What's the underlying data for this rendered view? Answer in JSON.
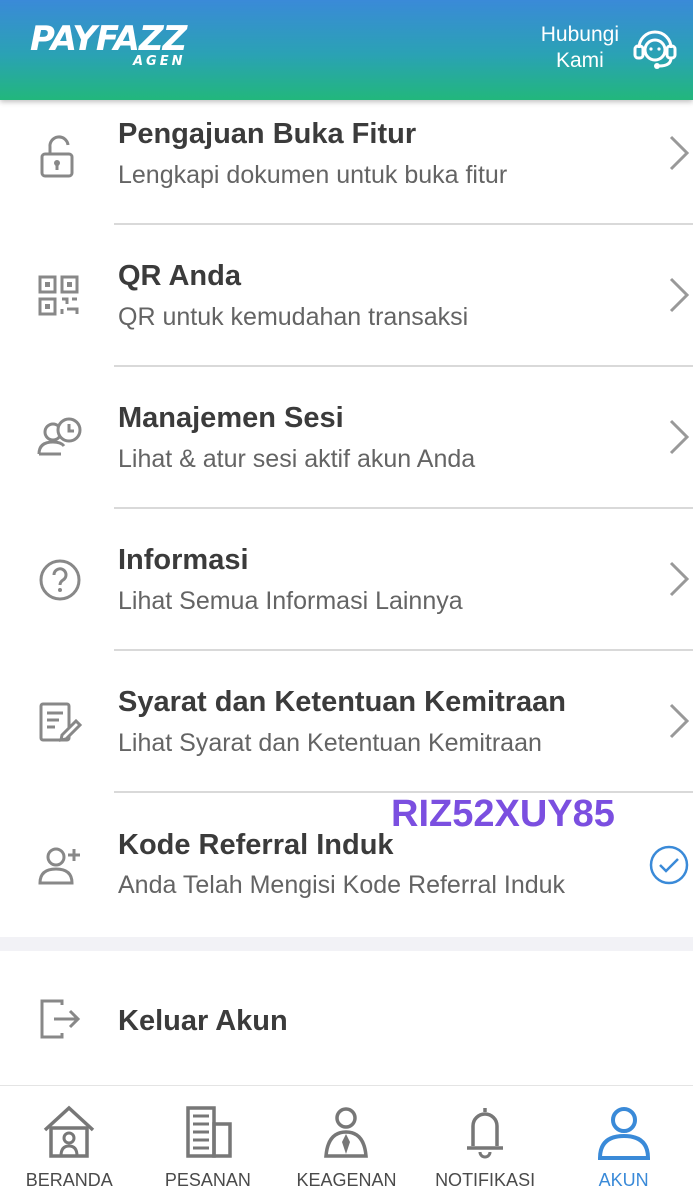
{
  "header": {
    "logo_main": "PAYFAZZ",
    "logo_sub": "AGEN",
    "contact_line1": "Hubungi",
    "contact_line2": "Kami",
    "contact_icon": "headset-support-icon"
  },
  "menu": {
    "items": [
      {
        "title": "Pengajuan Buka Fitur",
        "subtitle": "Lengkapi dokumen untuk buka fitur",
        "icon": "unlock-icon"
      },
      {
        "title": "QR Anda",
        "subtitle": "QR untuk kemudahan transaksi",
        "icon": "qr-code-icon"
      },
      {
        "title": "Manajemen Sesi",
        "subtitle": "Lihat & atur sesi aktif akun Anda",
        "icon": "user-clock-icon"
      },
      {
        "title": "Informasi",
        "subtitle": "Lihat Semua Informasi Lainnya",
        "icon": "question-circle-icon"
      },
      {
        "title": "Syarat dan Ketentuan Kemitraan",
        "subtitle": "Lihat Syarat dan Ketentuan Kemitraan",
        "icon": "document-edit-icon"
      },
      {
        "title": "Kode Referral Induk",
        "subtitle": "Anda Telah Mengisi Kode Referral Induk",
        "icon": "add-user-icon"
      }
    ],
    "referral_code": "RIZ52XUY85",
    "logout_label": "Keluar Akun"
  },
  "bottom_nav": {
    "items": [
      {
        "label": "BERANDA",
        "icon": "home-icon"
      },
      {
        "label": "PESANAN",
        "icon": "orders-icon"
      },
      {
        "label": "KEAGENAN",
        "icon": "agent-icon"
      },
      {
        "label": "NOTIFIKASI",
        "icon": "bell-icon"
      },
      {
        "label": "AKUN",
        "icon": "account-icon"
      }
    ],
    "active": "AKUN"
  },
  "colors": {
    "header_gradient_top": "#3a8ad8",
    "header_gradient_bottom": "#22b77c",
    "active_nav": "#3a8ad8",
    "referral_code": "#7b4fe0"
  }
}
